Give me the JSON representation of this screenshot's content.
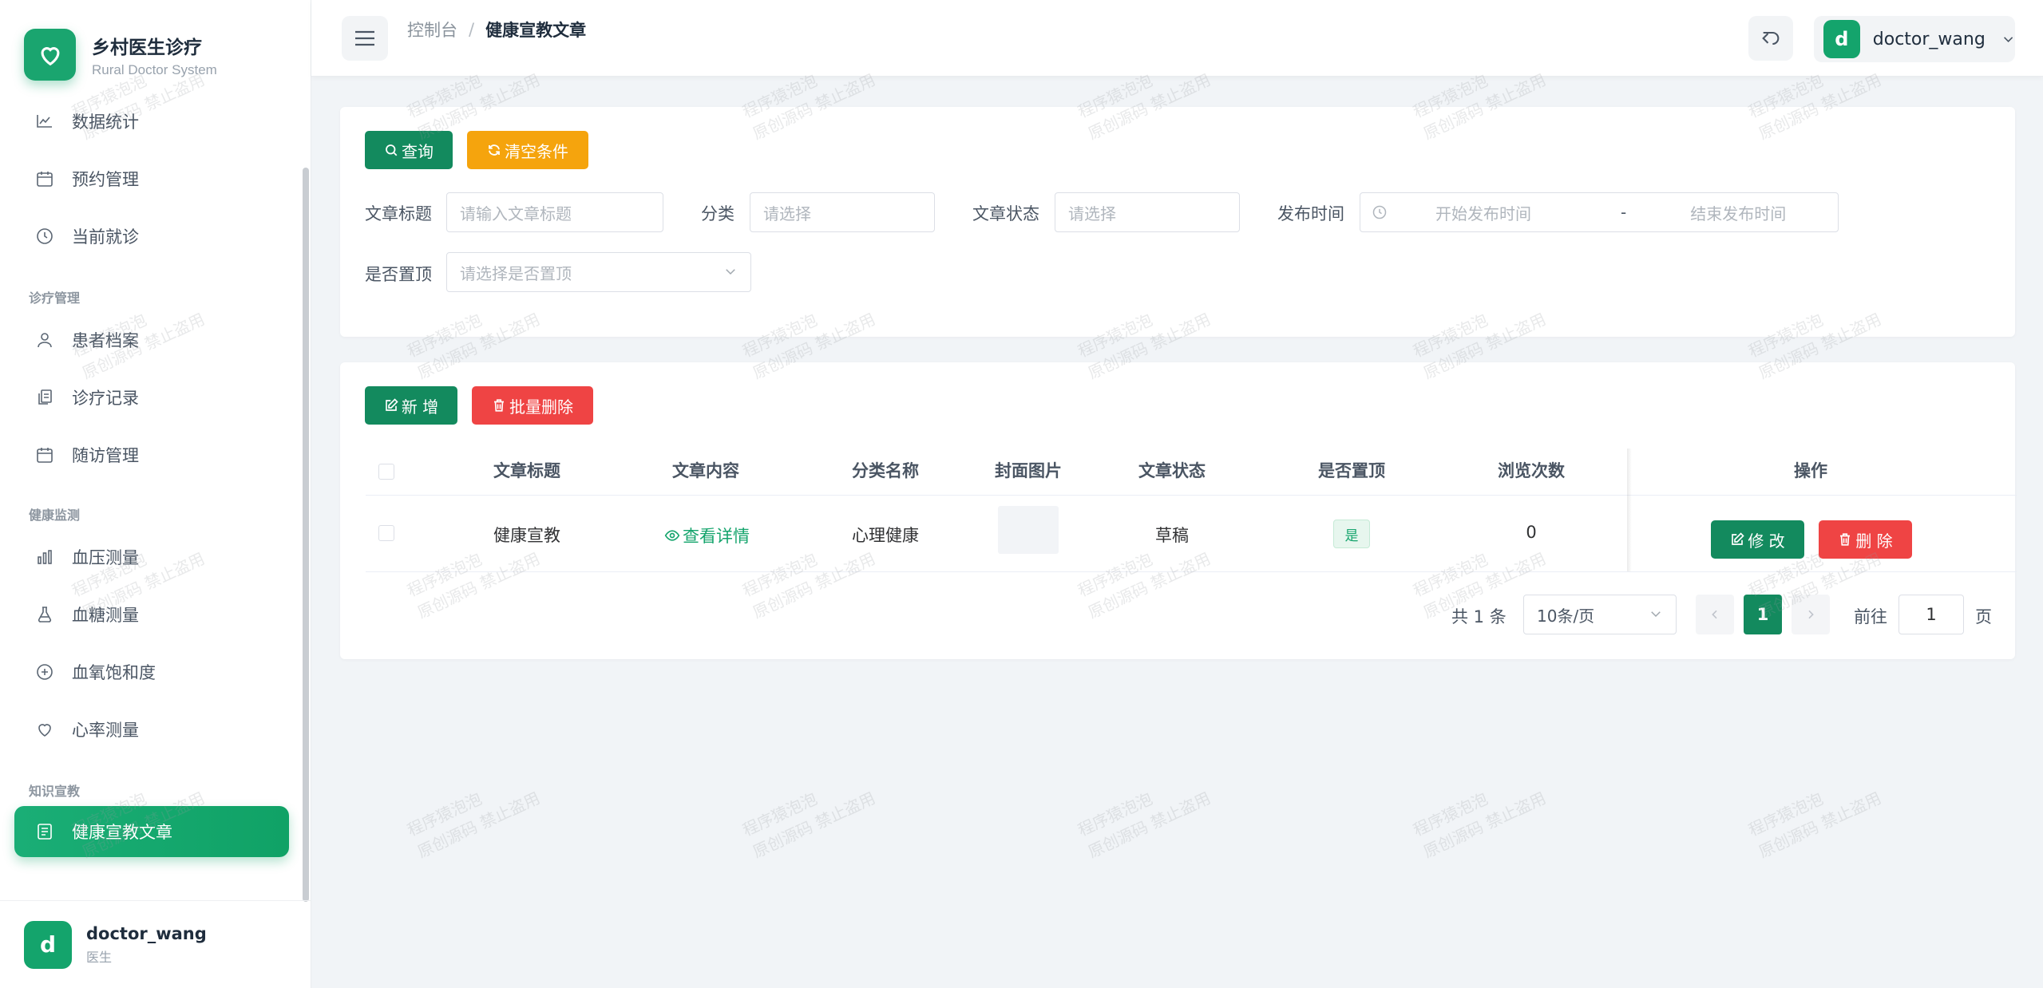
{
  "brand": {
    "title": "乡村医生诊疗",
    "subtitle": "Rural Doctor System"
  },
  "sidebar": {
    "items_top": [
      {
        "label": "数据统计",
        "icon": "chart-icon"
      },
      {
        "label": "预约管理",
        "icon": "calendar-icon"
      },
      {
        "label": "当前就诊",
        "icon": "clock-icon"
      }
    ],
    "group_diagnosis": "诊疗管理",
    "items_diagnosis": [
      {
        "label": "患者档案",
        "icon": "user-icon"
      },
      {
        "label": "诊疗记录",
        "icon": "copy-icon"
      },
      {
        "label": "随访管理",
        "icon": "calendar-icon"
      }
    ],
    "group_health": "健康监测",
    "items_health": [
      {
        "label": "血压测量",
        "icon": "bar-chart-icon"
      },
      {
        "label": "血糖测量",
        "icon": "flask-icon"
      },
      {
        "label": "血氧饱和度",
        "icon": "plus-circle-icon"
      },
      {
        "label": "心率测量",
        "icon": "heart-icon"
      }
    ],
    "group_knowledge": "知识宣教",
    "active_item": {
      "label": "健康宣教文章",
      "icon": "document-icon"
    }
  },
  "user": {
    "initial": "d",
    "name": "doctor_wang",
    "role": "医生"
  },
  "header": {
    "breadcrumb_first": "控制台",
    "breadcrumb_sep": "/",
    "breadcrumb_current": "健康宣教文章",
    "user_initial": "d",
    "user_name": "doctor_wang"
  },
  "search": {
    "query_label": "查询",
    "clear_label": "清空条件",
    "title_label": "文章标题",
    "title_placeholder": "请输入文章标题",
    "category_label": "分类",
    "category_placeholder": "请选择",
    "status_label": "文章状态",
    "status_placeholder": "请选择",
    "publish_label": "发布时间",
    "publish_start": "开始发布时间",
    "publish_sep": "-",
    "publish_end": "结束发布时间",
    "top_label": "是否置顶",
    "top_placeholder": "请选择是否置顶"
  },
  "toolbar": {
    "add_label": "新 增",
    "batch_delete_label": "批量删除"
  },
  "table": {
    "headers": [
      "文章标题",
      "文章内容",
      "分类名称",
      "封面图片",
      "文章状态",
      "是否置顶",
      "浏览次数",
      "操作"
    ],
    "rows": [
      {
        "title": "健康宣教",
        "content_link": "查看详情",
        "category": "心理健康",
        "status": "草稿",
        "is_top": "是",
        "views": "0",
        "edit_label": "修 改",
        "delete_label": "删 除"
      }
    ]
  },
  "pagination": {
    "total": "共 1 条",
    "page_size": "10条/页",
    "current_page": "1",
    "goto_label": "前往",
    "goto_value": "1",
    "page_suffix": "页"
  },
  "watermark": {
    "line1": "程序猿泡泡",
    "line2": "原创源码 禁止盗用"
  },
  "colors": {
    "primary": "#138a5e",
    "accent": "#14a46c",
    "warning": "#f5a40d",
    "danger": "#ef4444"
  }
}
